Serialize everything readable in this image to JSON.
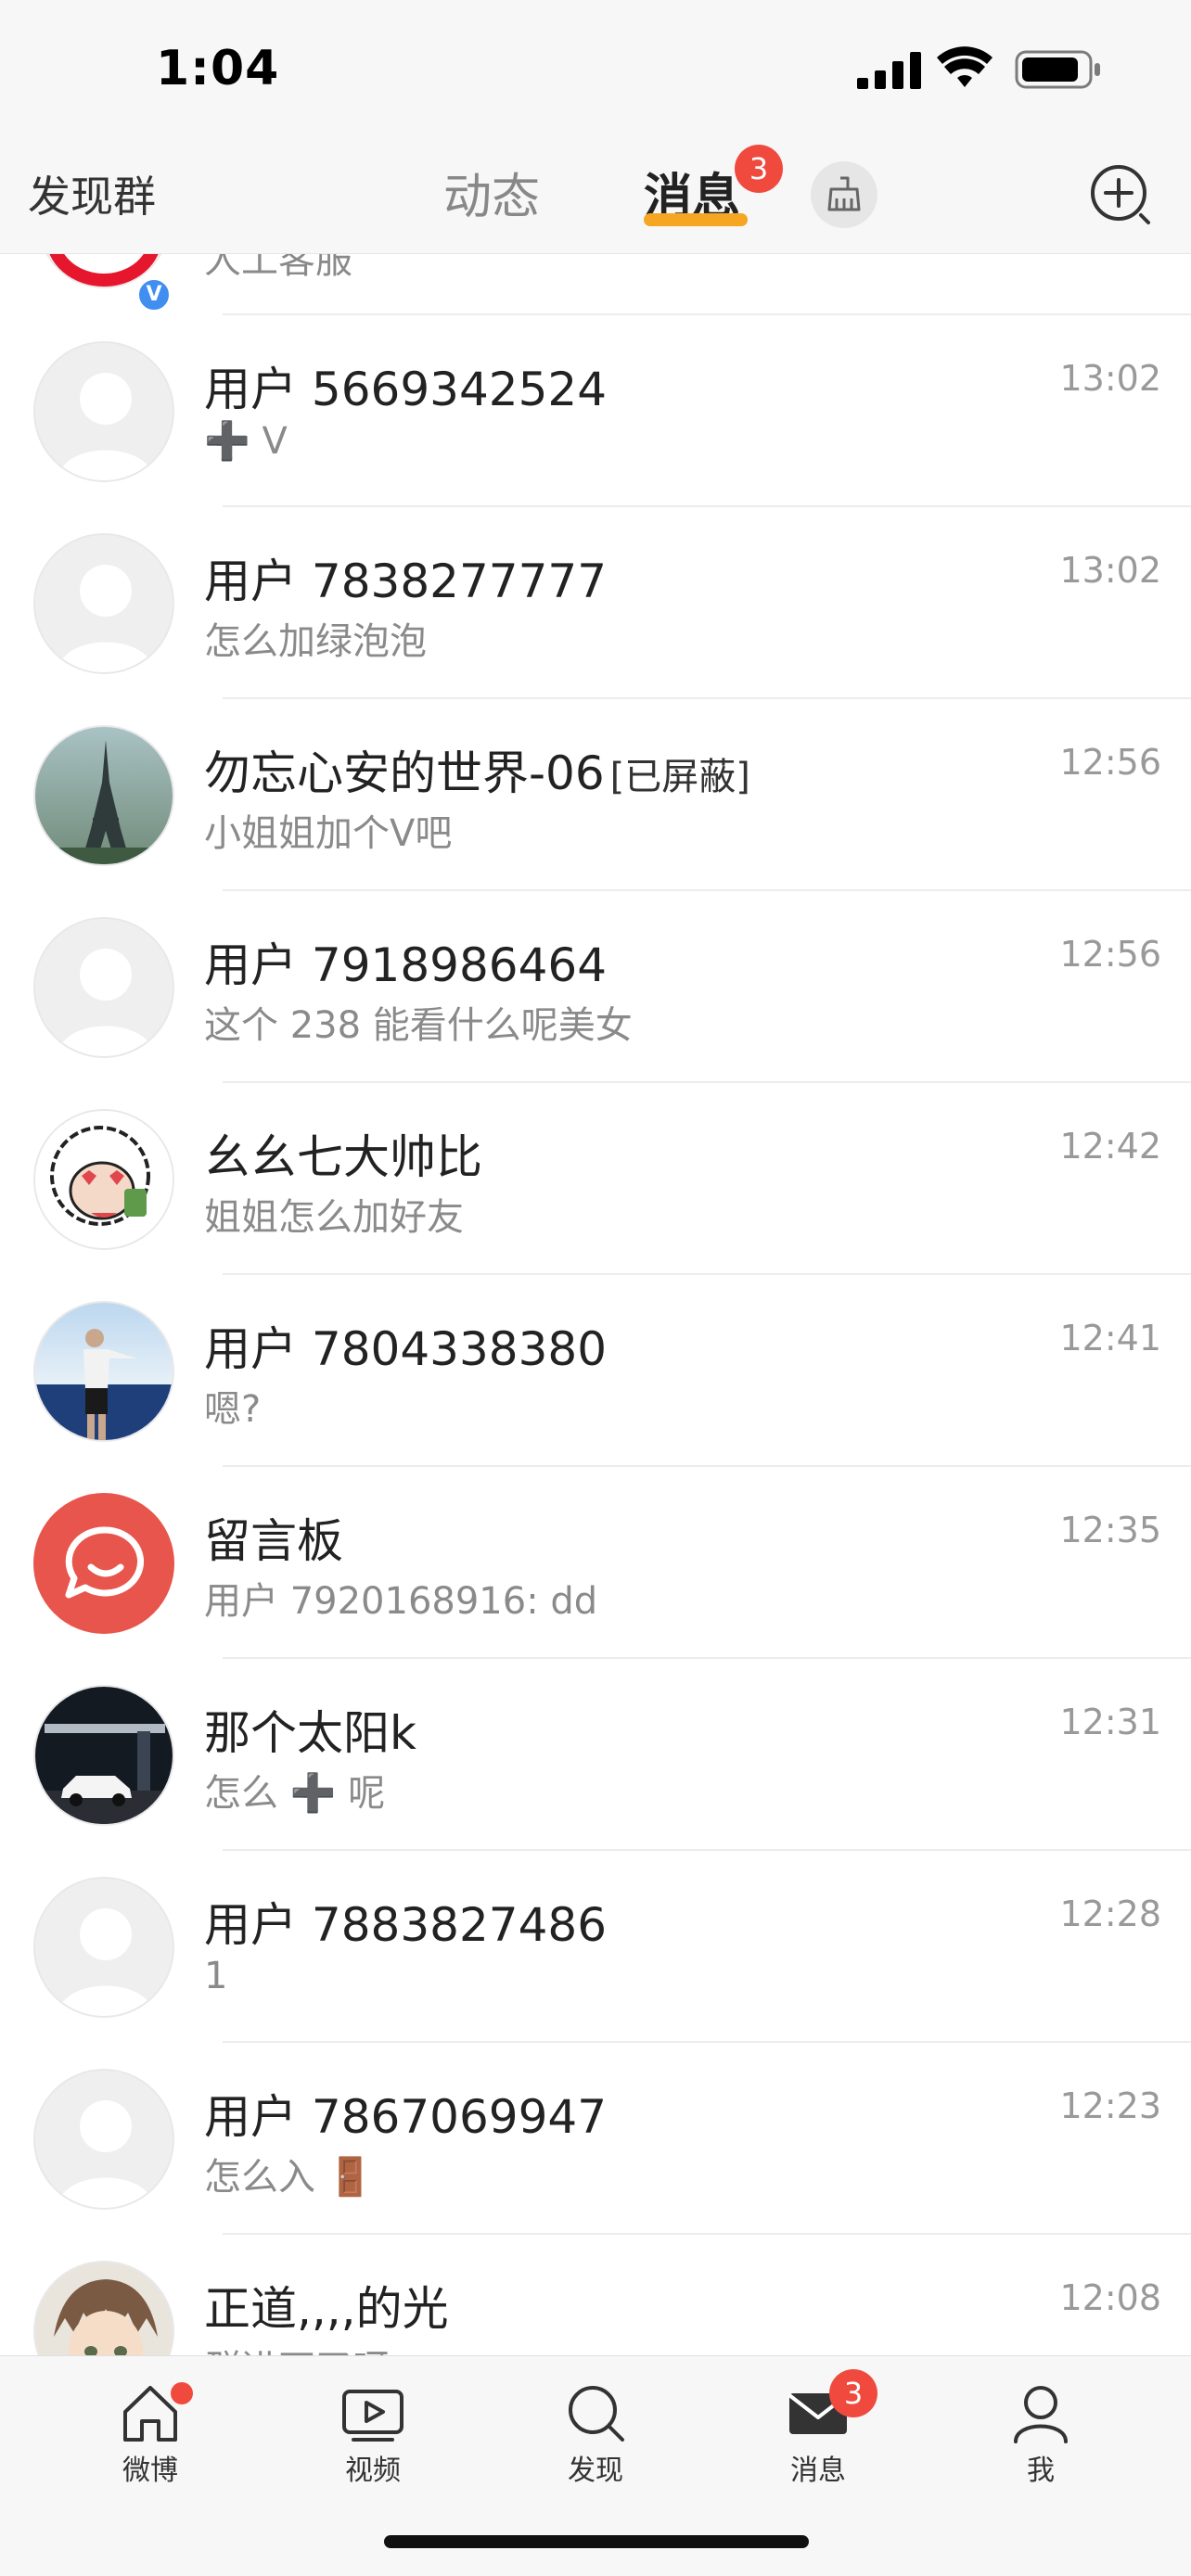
{
  "status_bar": {
    "time": "1:04"
  },
  "top_nav": {
    "left_label": "发现群",
    "tab_dynamic": "动态",
    "tab_messages": "消息",
    "messages_badge": "3",
    "accent_color": "#f5a623"
  },
  "top_partial_row": {
    "preview": "人工客服"
  },
  "messages": [
    {
      "name": "用户 5669342524",
      "tag": "",
      "preview": "➕ V",
      "time": "13:02",
      "avatar": "default-avatar"
    },
    {
      "name": "用户 7838277777",
      "tag": "",
      "preview": "怎么加绿泡泡",
      "time": "13:02",
      "avatar": "default-avatar"
    },
    {
      "name": "勿忘心安的世界-06",
      "tag": "[已屏蔽]",
      "preview": "小姐姐加个V吧",
      "time": "12:56",
      "avatar": "eiffel-tower-photo"
    },
    {
      "name": "用户 7918986464",
      "tag": "",
      "preview": "这个 238 能看什么呢美女",
      "time": "12:56",
      "avatar": "default-avatar"
    },
    {
      "name": "幺幺七大帅比",
      "tag": "",
      "preview": "姐姐怎么加好友",
      "time": "12:42",
      "avatar": "cartoon-sheep"
    },
    {
      "name": "用户 7804338380",
      "tag": "",
      "preview": "嗯?",
      "time": "12:41",
      "avatar": "sea-photo"
    },
    {
      "name": "留言板",
      "tag": "",
      "preview": "用户 7920168916: dd",
      "time": "12:35",
      "avatar": "message-board-icon"
    },
    {
      "name": "那个太阳k",
      "tag": "",
      "preview": "怎么 ➕ 呢",
      "time": "12:31",
      "avatar": "car-night-photo"
    },
    {
      "name": "用户 7883827486",
      "tag": "",
      "preview": "1",
      "time": "12:28",
      "avatar": "default-avatar"
    },
    {
      "name": "用户 7867069947",
      "tag": "",
      "preview": "怎么入 🚪",
      "time": "12:23",
      "avatar": "default-avatar"
    },
    {
      "name": "正道,,,,的光",
      "tag": "",
      "preview": "群进不了呀",
      "time": "12:08",
      "avatar": "anime-boy"
    }
  ],
  "bottom_tabs": [
    {
      "label": "微博",
      "icon": "home-icon"
    },
    {
      "label": "视频",
      "icon": "video-icon"
    },
    {
      "label": "发现",
      "icon": "search-icon"
    },
    {
      "label": "消息",
      "icon": "mail-icon",
      "badge": "3"
    },
    {
      "label": "我",
      "icon": "user-icon"
    }
  ]
}
